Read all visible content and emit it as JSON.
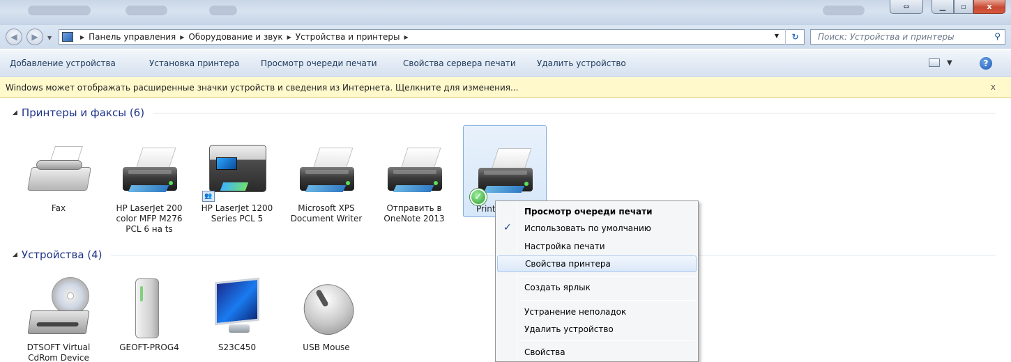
{
  "window": {
    "close_glyph": "x",
    "restore_glyph": "⇔"
  },
  "address": {
    "crumbs": [
      "Панель управления",
      "Оборудование и звук",
      "Устройства и принтеры"
    ],
    "search_placeholder": "Поиск: Устройства и принтеры"
  },
  "commands": {
    "add_device": "Добавление устройства",
    "install_printer": "Установка принтера",
    "print_queue": "Просмотр очереди печати",
    "server_props": "Свойства сервера печати",
    "remove_device": "Удалить устройство"
  },
  "infobar": {
    "text": "Windows может отображать расширенные значки устройств и сведения из Интернета.  Щелкните для изменения...",
    "close": "x"
  },
  "groups": {
    "printers": {
      "title": "Принтеры и факсы (6)",
      "items": [
        {
          "label": "Fax",
          "icon": "fax-icon"
        },
        {
          "label": "HP LaserJet 200 color MFP M276 PCL 6 на ts",
          "icon": "printer-icon"
        },
        {
          "label": "HP LaserJet 1200 Series PCL 5",
          "icon": "mfp-printer-icon"
        },
        {
          "label": "Microsoft XPS Document Writer",
          "icon": "printer-icon"
        },
        {
          "label": "Отправить в OneNote 2013",
          "icon": "printer-icon"
        },
        {
          "label": "Print",
          "icon": "printer-icon"
        }
      ]
    },
    "devices": {
      "title": "Устройства (4)",
      "items": [
        {
          "label": "DTSOFT Virtual CdRom Device",
          "icon": "cdrom-icon"
        },
        {
          "label": "GEOFT-PROG4",
          "icon": "computer-icon"
        },
        {
          "label": "S23C450",
          "icon": "monitor-icon"
        },
        {
          "label": "USB Mouse",
          "icon": "mouse-icon"
        }
      ]
    }
  },
  "context_menu": {
    "items": [
      {
        "label": "Просмотр очереди печати",
        "bold": true
      },
      {
        "label": "Использовать по умолчанию",
        "checked": true
      },
      {
        "label": "Настройка печати"
      },
      {
        "label": "Свойства принтера",
        "hovered": true
      },
      {
        "label": "Создать ярлык"
      },
      {
        "label": "Устранение неполадок"
      },
      {
        "label": "Удалить устройство"
      },
      {
        "label": "Свойства"
      }
    ]
  },
  "colors": {
    "group_heading": "#1e3287",
    "infobar_bg": "#fff9cc",
    "selection_border": "#84acdd"
  }
}
